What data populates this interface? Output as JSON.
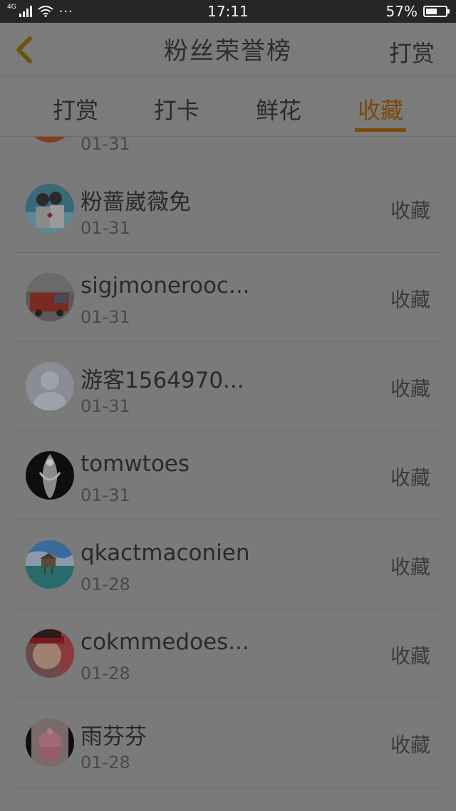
{
  "status_bar": {
    "network": "4G",
    "time": "17:11",
    "battery": "57%",
    "battery_level": 0.57,
    "more": "···"
  },
  "header": {
    "title": "粉丝荣誉榜",
    "action_label": "打赏"
  },
  "tabs": [
    {
      "label": "打赏",
      "active": false
    },
    {
      "label": "打卡",
      "active": false
    },
    {
      "label": "鲜花",
      "active": false
    },
    {
      "label": "收藏",
      "active": true
    }
  ],
  "partial_row": {
    "date": "01-31"
  },
  "rows": [
    {
      "name": "粉蔷崴薇免",
      "date": "01-31",
      "action": "收藏",
      "avatar": "couple-photo-avatar"
    },
    {
      "name": "sigjmonerooc...",
      "date": "01-31",
      "action": "收藏",
      "avatar": "fire-truck-avatar"
    },
    {
      "name": "游客1564970...",
      "date": "01-31",
      "action": "收藏",
      "avatar": "default-user-avatar"
    },
    {
      "name": "tomwtoes",
      "date": "01-31",
      "action": "收藏",
      "avatar": "anime-girl-avatar"
    },
    {
      "name": "qkactmaconien",
      "date": "01-28",
      "action": "收藏",
      "avatar": "seaside-hut-avatar"
    },
    {
      "name": "cokmmedoes...",
      "date": "01-28",
      "action": "收藏",
      "avatar": "person-red-headband-avatar"
    },
    {
      "name": "雨芬芬",
      "date": "01-28",
      "action": "收藏",
      "avatar": "pink-cake-avatar"
    }
  ],
  "colors": {
    "accent": "#7a4a0a",
    "overlay_bg": "#7a7a7a",
    "status_bar_bg": "#262626"
  }
}
